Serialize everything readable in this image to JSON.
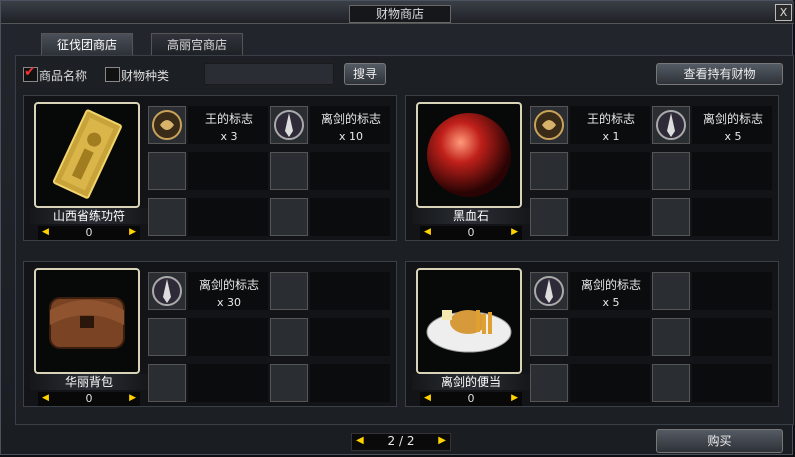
{
  "window": {
    "title": "财物商店",
    "close": "X"
  },
  "tabs": [
    {
      "label": "征伐团商店",
      "active": true
    },
    {
      "label": "高丽宫商店",
      "active": false
    }
  ],
  "filters": {
    "name_label": "商品名称",
    "name_checked": true,
    "type_label": "财物种类",
    "type_checked": false,
    "search_value": "",
    "search_button": "搜寻"
  },
  "view_button": "查看持有财物",
  "items": [
    {
      "name": "山西省练功符",
      "qty": "0",
      "icon": "golden-talisman-icon",
      "materials": [
        {
          "name": "王的标志",
          "count": "x 3",
          "icon": "king-emblem-icon"
        },
        {
          "name": "离剑的标志",
          "count": "x 10",
          "icon": "sword-emblem-icon"
        }
      ]
    },
    {
      "name": "黑血石",
      "qty": "0",
      "icon": "black-blood-stone-icon",
      "materials": [
        {
          "name": "王的标志",
          "count": "x 1",
          "icon": "king-emblem-icon"
        },
        {
          "name": "离剑的标志",
          "count": "x 5",
          "icon": "sword-emblem-icon"
        }
      ]
    },
    {
      "name": "华丽背包",
      "qty": "0",
      "icon": "leather-bag-icon",
      "materials": [
        {
          "name": "离剑的标志",
          "count": "x 30",
          "icon": "sword-emblem-icon"
        }
      ]
    },
    {
      "name": "离剑的便当",
      "qty": "0",
      "icon": "lunchbox-icon",
      "materials": [
        {
          "name": "离剑的标志",
          "count": "x 5",
          "icon": "sword-emblem-icon"
        }
      ]
    }
  ],
  "pagination": {
    "text": "2 / 2"
  },
  "buy_button": "购买",
  "colors": {
    "accent_yellow": "#ffd200",
    "check_red": "#e33333",
    "frame": "#d9d3b8"
  }
}
